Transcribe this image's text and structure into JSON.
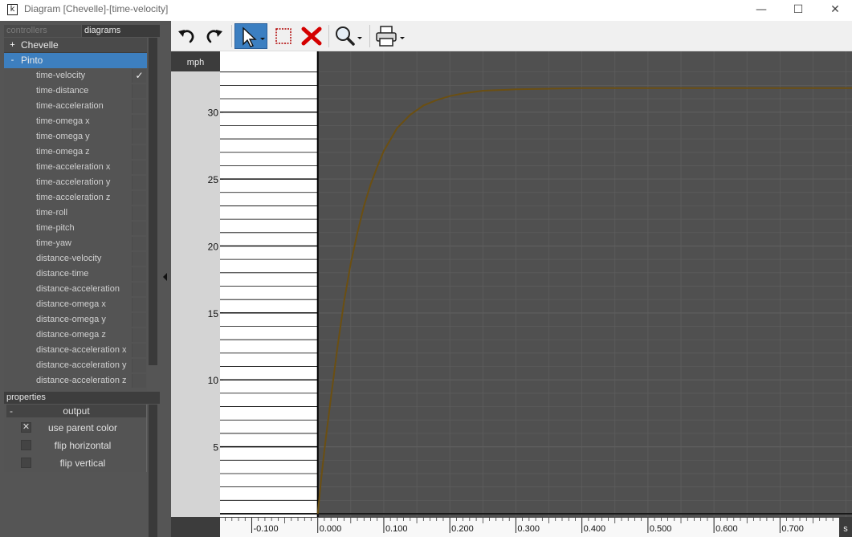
{
  "window": {
    "title": "Diagram [Chevelle]-[time-velocity]",
    "app_icon_glyph": "k",
    "minimize_glyph": "—",
    "maximize_glyph": "☐",
    "close_glyph": "✕"
  },
  "tabs": {
    "controllers": "controllers",
    "diagrams": "diagrams"
  },
  "tree": {
    "chevelle": {
      "toggle": "+",
      "label": "Chevelle"
    },
    "pinto": {
      "toggle": "-",
      "label": "Pinto"
    },
    "items": [
      {
        "label": "time-velocity",
        "check": "✓"
      },
      {
        "label": "time-distance",
        "check": ""
      },
      {
        "label": "time-acceleration",
        "check": ""
      },
      {
        "label": "time-omega x",
        "check": ""
      },
      {
        "label": "time-omega y",
        "check": ""
      },
      {
        "label": "time-omega z",
        "check": ""
      },
      {
        "label": "time-acceleration x",
        "check": ""
      },
      {
        "label": "time-acceleration y",
        "check": ""
      },
      {
        "label": "time-acceleration z",
        "check": ""
      },
      {
        "label": "time-roll",
        "check": ""
      },
      {
        "label": "time-pitch",
        "check": ""
      },
      {
        "label": "time-yaw",
        "check": ""
      },
      {
        "label": "distance-velocity",
        "check": ""
      },
      {
        "label": "distance-time",
        "check": ""
      },
      {
        "label": "distance-acceleration",
        "check": ""
      },
      {
        "label": "distance-omega x",
        "check": ""
      },
      {
        "label": "distance-omega y",
        "check": ""
      },
      {
        "label": "distance-omega z",
        "check": ""
      },
      {
        "label": "distance-acceleration x",
        "check": ""
      },
      {
        "label": "distance-acceleration y",
        "check": ""
      },
      {
        "label": "distance-acceleration z",
        "check": ""
      }
    ]
  },
  "properties": {
    "header": "properties",
    "output_toggle": "-",
    "output_label": "output",
    "items": [
      {
        "label": "use parent color",
        "checked": "✕"
      },
      {
        "label": "flip horizontal",
        "checked": ""
      },
      {
        "label": "flip vertical",
        "checked": ""
      }
    ]
  },
  "toolbar": {
    "icons": [
      "undo-icon",
      "redo-icon",
      "select-arrow-icon",
      "rect-select-icon",
      "delete-x-icon",
      "zoom-icon",
      "print-icon"
    ],
    "selected_tool": "select"
  },
  "chart_data": {
    "type": "line",
    "ylabel": "mph",
    "xlabel": "s",
    "xlim": [
      -0.148,
      0.809
    ],
    "ylim": [
      0,
      33.1
    ],
    "x_ticks": [
      -0.1,
      0.0,
      0.1,
      0.2,
      0.3,
      0.4,
      0.5,
      0.6,
      0.7
    ],
    "x_tick_labels": [
      "-0.100",
      "0.000",
      "0.100",
      "0.200",
      "0.300",
      "0.400",
      "0.500",
      "0.600",
      "0.700"
    ],
    "y_ticks": [
      5,
      10,
      15,
      20,
      25,
      30
    ],
    "y_tick_labels": [
      "5",
      "10",
      "15",
      "20",
      "25",
      "30"
    ],
    "grid": true,
    "colors": {
      "plot_background": "#505050",
      "gridline": "#5e5e5e",
      "series_line": "#6b4f12",
      "y_label_background": "#3c3c3c"
    },
    "series": [
      {
        "x": [
          0.0,
          0.005,
          0.01,
          0.015,
          0.02,
          0.03,
          0.04,
          0.05,
          0.06,
          0.07,
          0.08,
          0.09,
          0.1,
          0.12,
          0.14,
          0.16,
          0.18,
          0.2,
          0.22,
          0.25,
          0.3,
          0.35,
          0.4,
          0.5,
          0.6,
          0.7,
          0.809
        ],
        "y": [
          0.0,
          2.5,
          4.7,
          6.7,
          8.7,
          12.5,
          15.9,
          18.7,
          21.0,
          23.0,
          24.6,
          25.9,
          27.1,
          28.8,
          29.8,
          30.5,
          30.9,
          31.2,
          31.4,
          31.6,
          31.7,
          31.75,
          31.8,
          31.8,
          31.8,
          31.8,
          31.8
        ]
      }
    ]
  }
}
